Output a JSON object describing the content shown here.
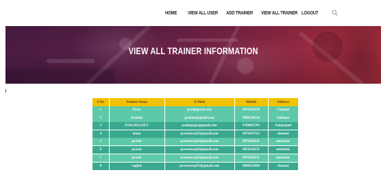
{
  "nav": {
    "home": "HOME",
    "view_all_user": "VIEW ALL USER",
    "add_trainer": "ADD TRAINER",
    "view_all_trainer": "VIEW ALL TRAINER",
    "logout": "LOGOUT"
  },
  "icons": {
    "search": "search-icon"
  },
  "hero": {
    "title": "VIEW ALL TRAINER INFORMATION"
  },
  "colors": {
    "header_row": "#f2c200",
    "row_light": "#5ec9a8",
    "row_dark": "#3aa98f",
    "hero_left": "#4b1c45",
    "hero_right": "#b0303f"
  },
  "table": {
    "columns": [
      "S.No",
      "Trainer Name",
      "E-Mail",
      "Mobile",
      "Address"
    ],
    "rows": [
      {
        "sno": "1",
        "name": "Prem",
        "email": "prel@gmail.com",
        "mobile": "9876543210",
        "address": "Chennai"
      },
      {
        "sno": "2",
        "name": "Jasmine",
        "email": "jasmine@gmail.com",
        "mobile": "9900330119",
        "address": "Saidapet"
      },
      {
        "sno": "3",
        "name": "PSALMGAJEY",
        "email": "psalmgajey@gmail.com",
        "mobile": "9788062763",
        "address": "Vadapalani"
      },
      {
        "sno": "4",
        "name": "demo",
        "email": "praveenraj22@gmail.com",
        "mobile": "9876547321",
        "address": "chennai"
      },
      {
        "sno": "5",
        "name": "pravin",
        "email": "praveenraj22@gmail.com",
        "mobile": "9876543211",
        "address": "ambattur"
      },
      {
        "sno": "6",
        "name": "pravin",
        "email": "praveenraj22@gmail.com",
        "mobile": "9876543211",
        "address": "ambattur"
      },
      {
        "sno": "7",
        "name": "pravin",
        "email": "praveenraj22@gmail.com",
        "mobile": "9876543211",
        "address": "ambattur"
      },
      {
        "sno": "8",
        "name": "raghul",
        "email": "praveenraj112@gmail.com",
        "mobile": "9884525894",
        "address": "chennai"
      }
    ]
  }
}
